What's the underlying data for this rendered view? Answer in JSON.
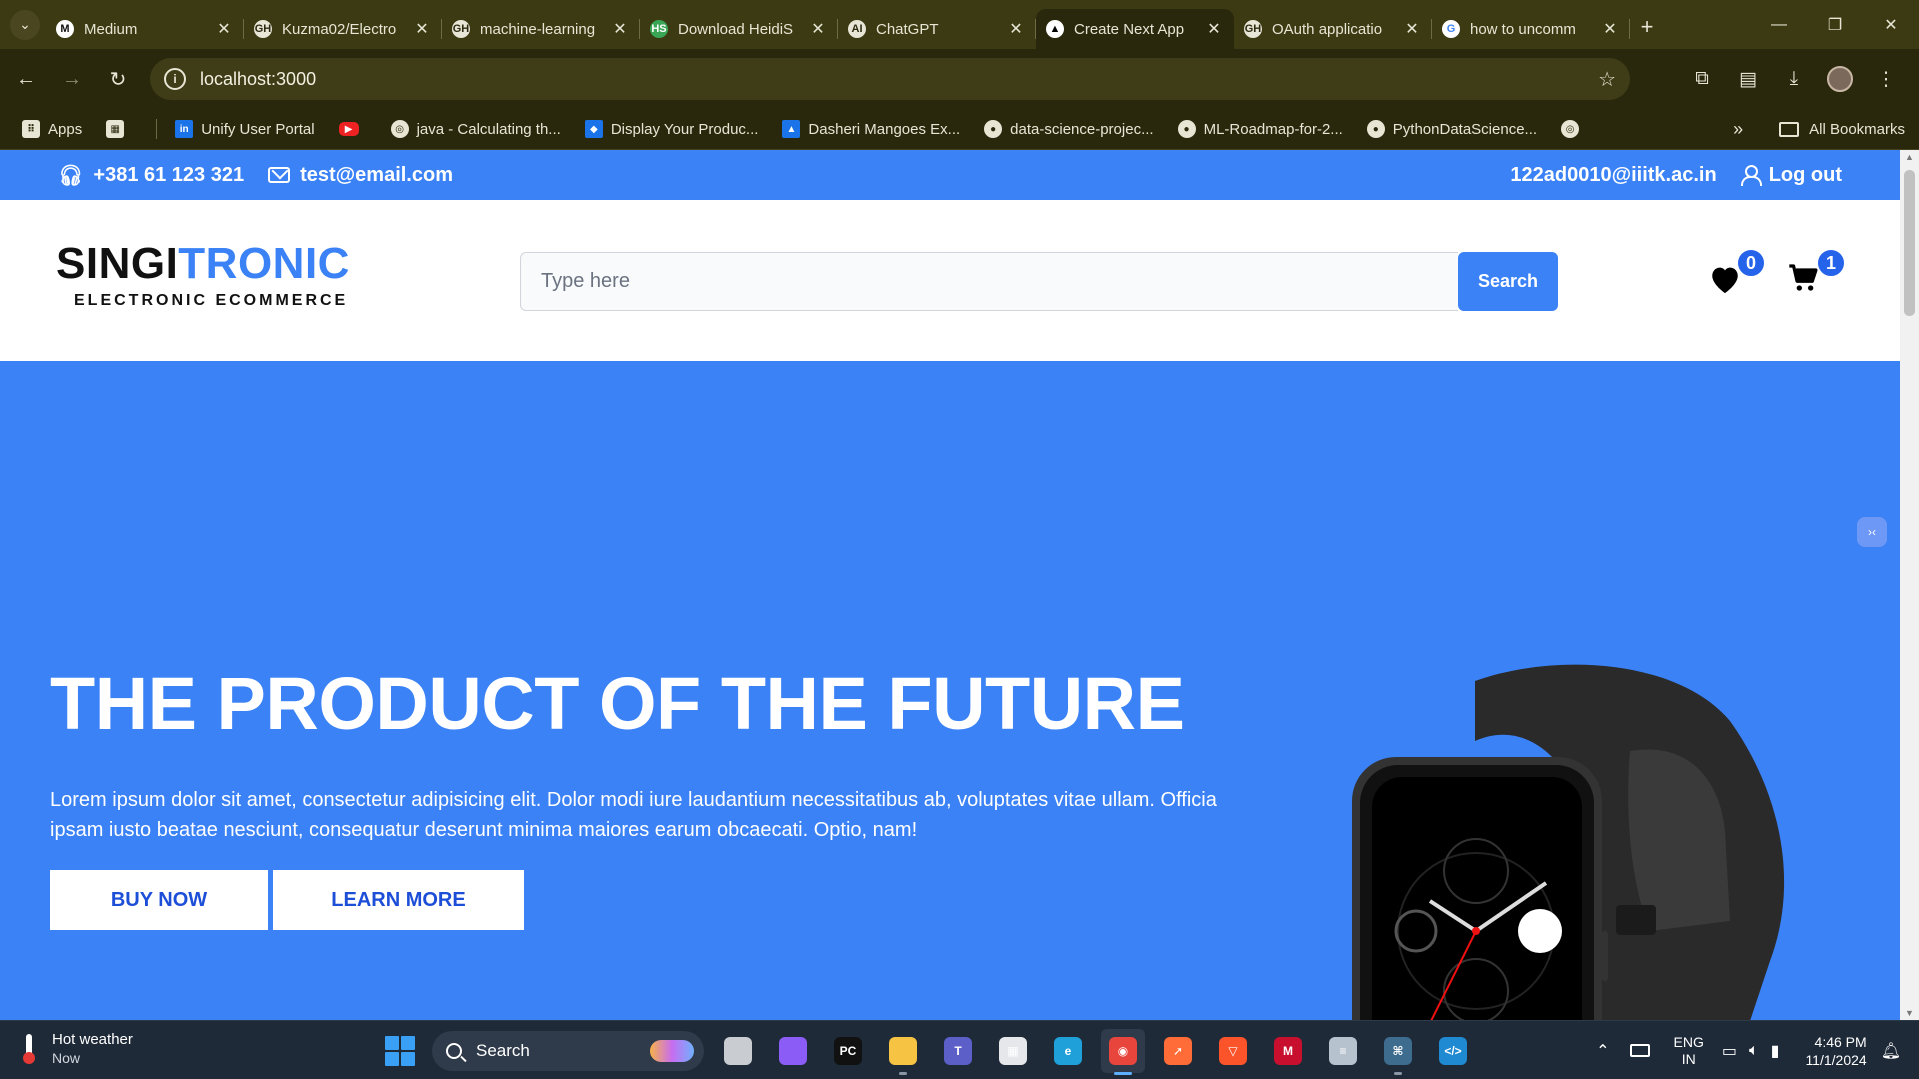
{
  "browser": {
    "tabs": [
      {
        "label": "Medium",
        "fav": "M",
        "fav_color": "#ffffff",
        "fav_text": "#111111",
        "active": false
      },
      {
        "label": "Kuzma02/Electro",
        "fav": "GH",
        "fav_color": "#e8e6d6",
        "fav_text": "#2b2a10",
        "active": false
      },
      {
        "label": "machine-learning",
        "fav": "GH",
        "fav_color": "#e8e6d6",
        "fav_text": "#2b2a10",
        "active": false
      },
      {
        "label": "Download HeidiS",
        "fav": "HS",
        "fav_color": "#3aa655",
        "fav_text": "#ffffff",
        "active": false
      },
      {
        "label": "ChatGPT",
        "fav": "AI",
        "fav_color": "#e8e6d6",
        "fav_text": "#2b2a10",
        "active": false
      },
      {
        "label": "Create Next App",
        "fav": "▲",
        "fav_color": "#ffffff",
        "fav_text": "#000000",
        "active": true
      },
      {
        "label": "OAuth applicatio",
        "fav": "GH",
        "fav_color": "#e8e6d6",
        "fav_text": "#2b2a10",
        "active": false
      },
      {
        "label": "how to uncomm",
        "fav": "G",
        "fav_color": "#ffffff",
        "fav_text": "#4285f4",
        "active": false
      }
    ],
    "url": "localhost:3000",
    "bookmarks": [
      {
        "label": "Apps",
        "icon": "apps-grid-icon"
      },
      {
        "label": "",
        "icon": "tab-groups-icon"
      },
      {
        "label": "Unify User Portal",
        "icon": "unify-icon"
      },
      {
        "label": "",
        "icon": "youtube-icon"
      },
      {
        "label": "java - Calculating th...",
        "icon": "globe-icon"
      },
      {
        "label": "Display Your Produc...",
        "icon": "display-icon"
      },
      {
        "label": "Dasheri Mangoes Ex...",
        "icon": "arrow-icon"
      },
      {
        "label": "data-science-projec...",
        "icon": "github-icon"
      },
      {
        "label": "ML-Roadmap-for-2...",
        "icon": "github-icon"
      },
      {
        "label": "PythonDataScience...",
        "icon": "github-icon"
      },
      {
        "label": "",
        "icon": "globe-icon"
      }
    ],
    "all_bookmarks": "All Bookmarks"
  },
  "site": {
    "phone": "+381 61 123 321",
    "email": "test@email.com",
    "user_email": "122ad0010@iiitk.ac.in",
    "logout": "Log out",
    "logo_part1": "SINGI",
    "logo_part2": "TRONIC",
    "logo_tagline": "ELECTRONIC ECOMMERCE",
    "search_placeholder": "Type here",
    "search_button": "Search",
    "wishlist_count": "0",
    "cart_count": "1",
    "accent_color": "#3b82f6"
  },
  "hero": {
    "title": "THE PRODUCT OF THE FUTURE",
    "description": "Lorem ipsum dolor sit amet, consectetur adipisicing elit. Dolor modi iure laudantium necessitatibus ab, voluptates vitae ullam. Officia ipsam iusto beatae nesciunt, consequatur deserunt minima maiores earum obcaecati. Optio, nam!",
    "buy_now": "BUY NOW",
    "learn_more": "LEARN MORE"
  },
  "taskbar": {
    "weather_title": "Hot weather",
    "weather_sub": "Now",
    "search_label": "Search",
    "apps": [
      {
        "name": "file-explorer-multitask-icon",
        "color": "#c9ccd1",
        "glyph": ""
      },
      {
        "name": "copilot-icon",
        "color": "#8b5cf6",
        "glyph": ""
      },
      {
        "name": "pycharm-icon",
        "color": "#111111",
        "glyph": "PC"
      },
      {
        "name": "folder-icon",
        "color": "#f6c342",
        "glyph": ""
      },
      {
        "name": "teams-icon",
        "color": "#5b5fc7",
        "glyph": "T"
      },
      {
        "name": "store-icon",
        "color": "#e5e7eb",
        "glyph": "▦"
      },
      {
        "name": "edge-icon",
        "color": "#1fa0d8",
        "glyph": "e"
      },
      {
        "name": "chrome-icon",
        "color": "#e8453c",
        "glyph": "◉"
      },
      {
        "name": "postman-icon",
        "color": "#ff6c37",
        "glyph": "➚"
      },
      {
        "name": "brave-icon",
        "color": "#fb542b",
        "glyph": "▽"
      },
      {
        "name": "mcafee-icon",
        "color": "#c8102e",
        "glyph": "M"
      },
      {
        "name": "db-icon",
        "color": "#b6c3cf",
        "glyph": "≡"
      },
      {
        "name": "mysql-workbench-icon",
        "color": "#3d6c8e",
        "glyph": "⌘"
      },
      {
        "name": "vscode-icon",
        "color": "#1f8ad2",
        "glyph": "&lt;/&gt;"
      }
    ],
    "lang1": "ENG",
    "lang2": "IN",
    "time": "4:46 PM",
    "date": "11/1/2024"
  }
}
